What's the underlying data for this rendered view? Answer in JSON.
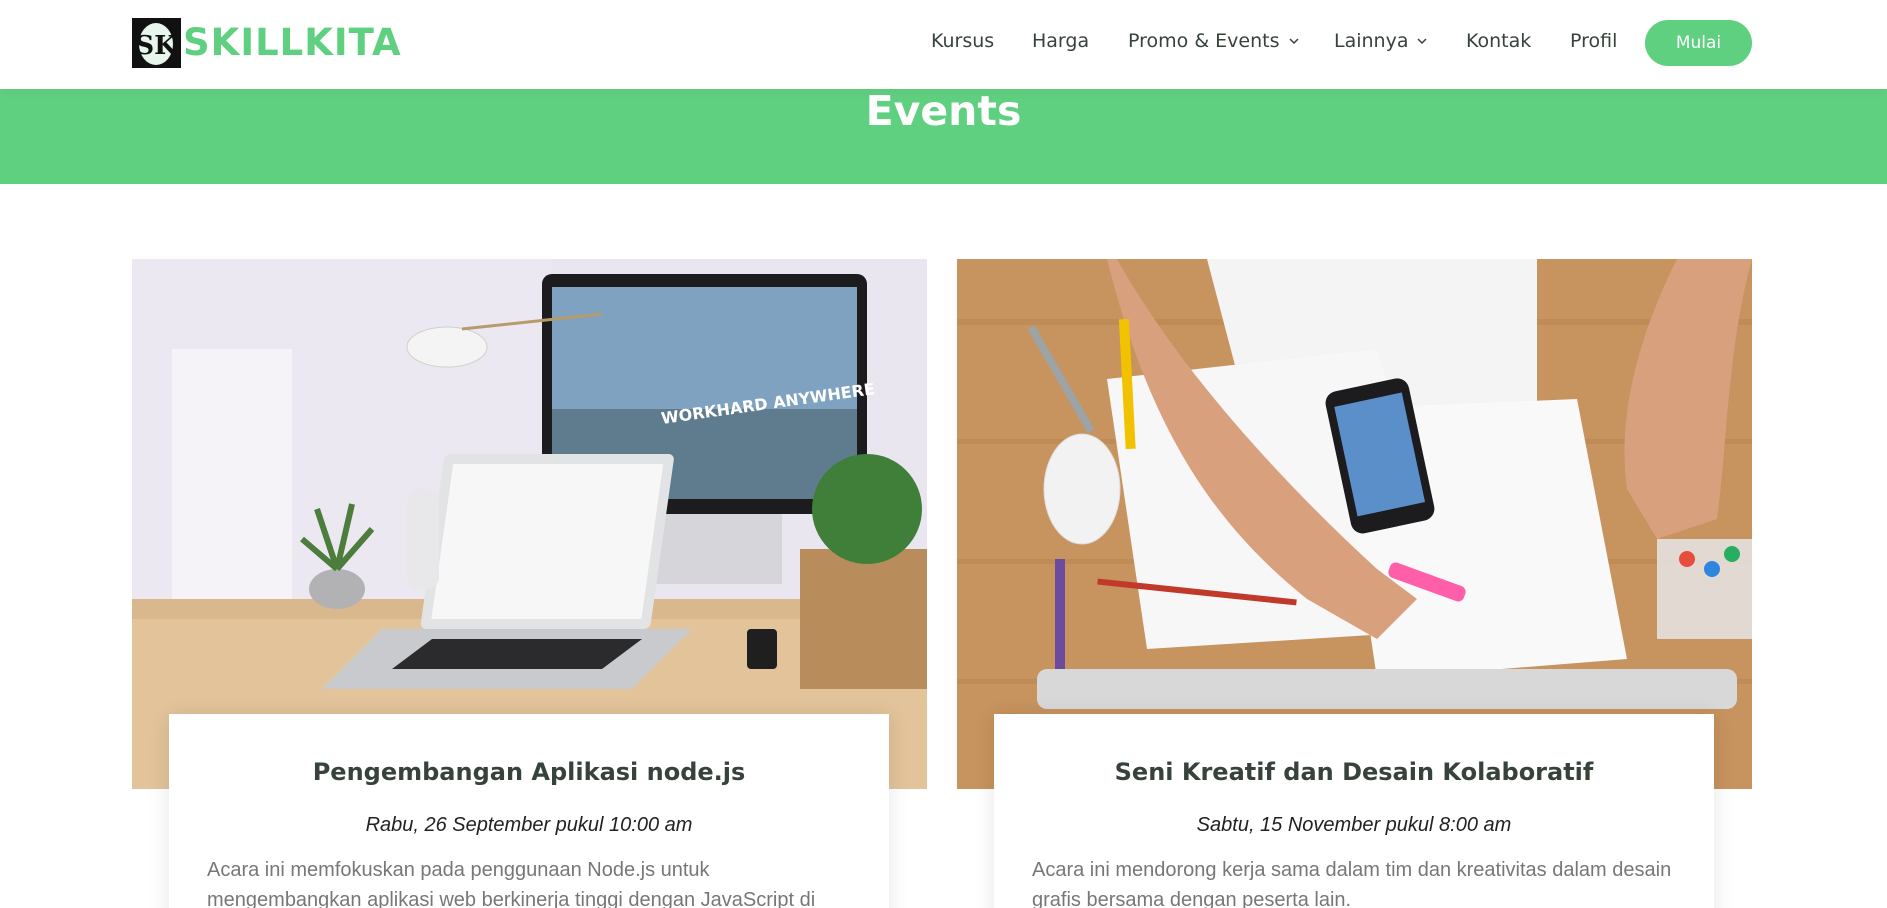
{
  "brand": {
    "logo_mark": "SK",
    "name": "SKILLKITA",
    "accent_color": "#5fcf80"
  },
  "nav": {
    "items": [
      {
        "label": "Kursus",
        "has_dropdown": false
      },
      {
        "label": "Harga",
        "has_dropdown": false
      },
      {
        "label": "Promo & Events",
        "has_dropdown": true
      },
      {
        "label": "Lainnya",
        "has_dropdown": true
      },
      {
        "label": "Kontak",
        "has_dropdown": false
      },
      {
        "label": "Profil",
        "has_dropdown": false
      }
    ],
    "cta_label": "Mulai"
  },
  "banner": {
    "title": "Events"
  },
  "events": [
    {
      "image_text": "WORKHARD ANYWHERE",
      "title": "Pengembangan Aplikasi node.js",
      "date": "Rabu, 26 September pukul 10:00 am",
      "description": "Acara ini memfokuskan pada penggunaan Node.js untuk mengembangkan aplikasi web berkinerja tinggi dengan JavaScript di"
    },
    {
      "image_text": "",
      "title": "Seni Kreatif dan Desain Kolaboratif",
      "date": "Sabtu, 15 November pukul 8:00 am",
      "description": "Acara ini mendorong kerja sama dalam tim dan kreativitas dalam desain grafis bersama dengan peserta lain."
    }
  ]
}
